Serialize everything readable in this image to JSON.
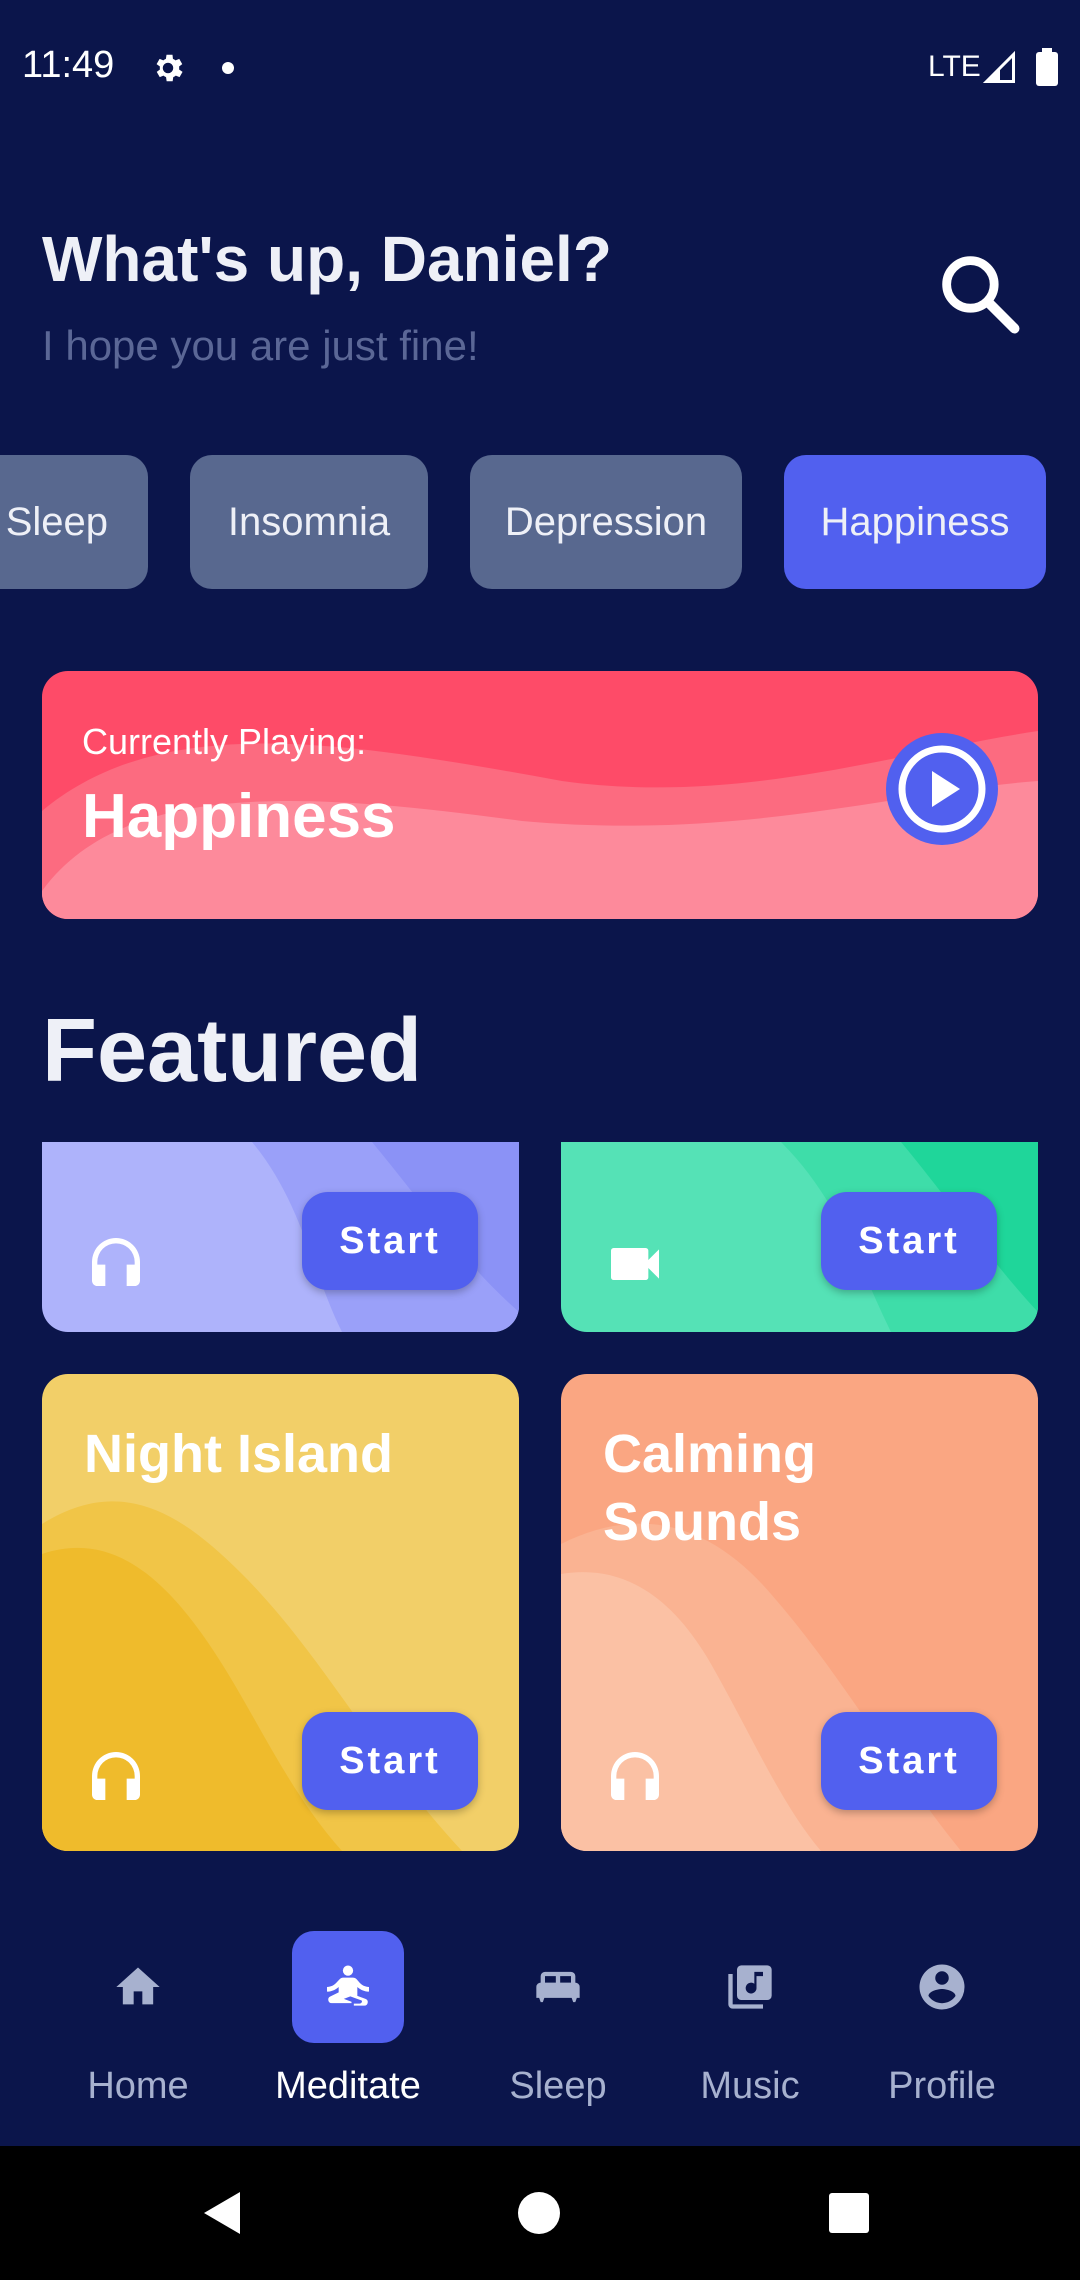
{
  "status_bar": {
    "time": "11:49",
    "network": "LTE"
  },
  "header": {
    "greeting": "What's up, Daniel?",
    "subtitle": "I hope you are just fine!"
  },
  "chips": [
    {
      "label": "Quiet Sleep",
      "visible_label": "t Sleep",
      "selected": false
    },
    {
      "label": "Insomnia",
      "selected": false
    },
    {
      "label": "Depression",
      "selected": false
    },
    {
      "label": "Happiness",
      "selected": true
    }
  ],
  "now_playing": {
    "label": "Currently Playing:",
    "title": "Happiness"
  },
  "featured": {
    "heading": "Featured",
    "cards": [
      {
        "title": "",
        "icon": "headphones-icon",
        "button": "Start",
        "color": "#aeb3fb"
      },
      {
        "title": "",
        "icon": "videocam-icon",
        "button": "Start",
        "color": "#55e2b6"
      },
      {
        "title": "Night Island",
        "icon": "headphones-icon",
        "button": "Start",
        "color": "#f2cf68"
      },
      {
        "title": "Calming Sounds",
        "icon": "headphones-icon",
        "button": "Start",
        "color": "#faa682"
      }
    ]
  },
  "bottom_nav": [
    {
      "label": "Home",
      "icon": "home-icon",
      "active": false
    },
    {
      "label": "Meditate",
      "icon": "meditate-icon",
      "active": true
    },
    {
      "label": "Sleep",
      "icon": "bed-icon",
      "active": false
    },
    {
      "label": "Music",
      "icon": "music-library-icon",
      "active": false
    },
    {
      "label": "Profile",
      "icon": "account-circle-icon",
      "active": false
    }
  ],
  "colors": {
    "background": "#0b154b",
    "accent": "#5160ef",
    "chip": "#58688f",
    "now_playing": "#fe4b68",
    "subtitle": "#5b6796"
  }
}
